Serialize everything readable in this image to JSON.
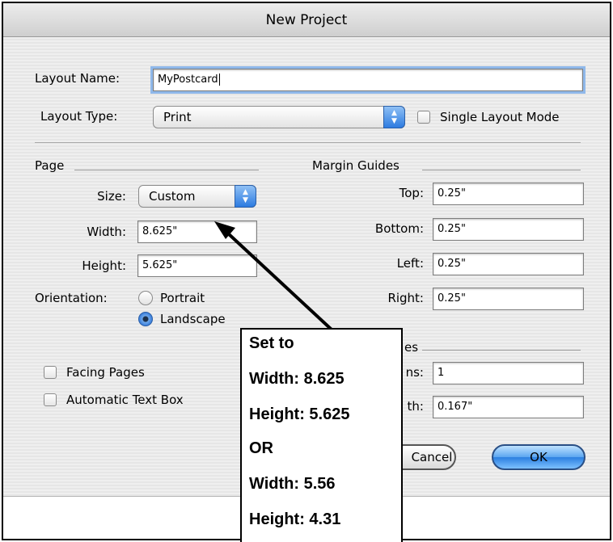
{
  "dialog": {
    "title": "New Project"
  },
  "layout": {
    "name_label": "Layout Name:",
    "name_value": "MyPostcard",
    "type_label": "Layout Type:",
    "type_value": "Print",
    "single_mode_label": "Single Layout Mode",
    "single_mode_checked": false
  },
  "page": {
    "heading": "Page",
    "size_label": "Size:",
    "size_value": "Custom",
    "width_label": "Width:",
    "width_value": "8.625\"",
    "height_label": "Height:",
    "height_value": "5.625\"",
    "orientation_label": "Orientation:",
    "portrait_label": "Portrait",
    "landscape_label": "Landscape",
    "selected_orientation": "Landscape",
    "facing_pages_label": "Facing Pages",
    "auto_text_box_label": "Automatic Text Box"
  },
  "margins": {
    "heading": "Margin Guides",
    "top_label": "Top:",
    "top_value": "0.25\"",
    "bottom_label": "Bottom:",
    "bottom_value": "0.25\"",
    "left_label": "Left:",
    "left_value": "0.25\"",
    "right_label": "Right:",
    "right_value": "0.25\""
  },
  "columns": {
    "heading_fragment": "es",
    "count_label_fragment": "ns:",
    "count_value": "1",
    "gutter_label_fragment": "th:",
    "gutter_value": "0.167\""
  },
  "buttons": {
    "cancel_fragment": "Cancel",
    "ok": "OK"
  },
  "callout": {
    "lines": [
      "Set to",
      "Width: 8.625",
      "Height: 5.625",
      "OR",
      "Width: 5.56",
      "Height: 4.31"
    ]
  },
  "colors": {
    "accent": "#2d7be0",
    "focus_ring": "#8fb8ea"
  }
}
